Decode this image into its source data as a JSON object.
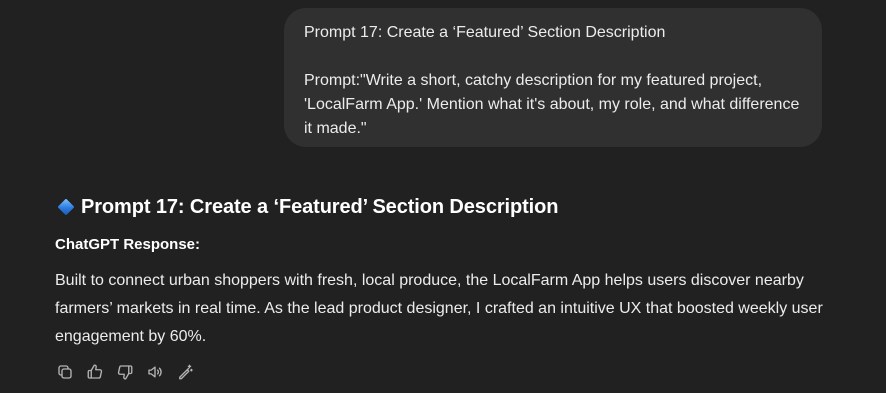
{
  "user_message": {
    "title": "Prompt 17: Create a ‘Featured’ Section Description",
    "body": "Prompt:\"Write a short, catchy description for my featured project, 'LocalFarm App.' Mention what it's about, my role, and what difference it made.\""
  },
  "response": {
    "heading": "Prompt 17: Create a ‘Featured’ Section Description",
    "label": "ChatGPT Response:",
    "text": "Built to connect urban shoppers with fresh, local produce, the LocalFarm App helps users discover nearby farmers’ markets in real time. As the lead product designer, I crafted an intuitive UX that boosted weekly user engagement by 60%."
  },
  "actions": [
    {
      "icon": "copy-icon"
    },
    {
      "icon": "thumbs-up-icon"
    },
    {
      "icon": "thumbs-down-icon"
    },
    {
      "icon": "read-aloud-icon"
    },
    {
      "icon": "edit-in-canvas-icon"
    }
  ],
  "colors": {
    "background": "#212121",
    "bubble": "#303030",
    "text": "#ececec",
    "icon": "#b4b4b4"
  }
}
